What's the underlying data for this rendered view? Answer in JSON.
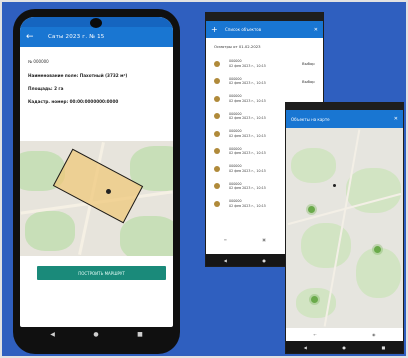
{
  "phone1": {
    "title": "Саты 2023 г. № 15",
    "back_icon": "arrow-left-icon",
    "record_id": "№ 000000",
    "rows": [
      "Наименование поле: Пахотный (3732 м²)",
      "Площадь: 2 га",
      "Кадастр. номер: 00:00:0000000:0000"
    ],
    "button_label": "ПОСТРОИТЬ МАРШРУТ",
    "colors": {
      "appbar": "#1976d2",
      "button": "#1a8a7a",
      "polygon": "#f0c878"
    }
  },
  "phone2": {
    "title": "Список объектов",
    "header": "Осмотры от 01.02.2023",
    "items": [
      {
        "line1": "000000",
        "line2": "02 фев 2023 г., 10:15",
        "tag": "Выбор"
      },
      {
        "line1": "000000",
        "line2": "02 фев 2023 г., 10:15",
        "tag": "Выбор"
      },
      {
        "line1": "000000",
        "line2": "02 фев 2023 г., 10:15",
        "tag": ""
      },
      {
        "line1": "000000",
        "line2": "02 фев 2023 г., 10:15",
        "tag": ""
      },
      {
        "line1": "000000",
        "line2": "02 фев 2023 г., 10:15",
        "tag": ""
      },
      {
        "line1": "000000",
        "line2": "02 фев 2023 г., 10:15",
        "tag": ""
      },
      {
        "line1": "000000",
        "line2": "02 фев 2023 г., 10:15",
        "tag": ""
      },
      {
        "line1": "000000",
        "line2": "02 фев 2023 г., 10:15",
        "tag": ""
      },
      {
        "line1": "000000",
        "line2": "02 фев 2023 г., 10:15",
        "tag": ""
      }
    ]
  },
  "phone3": {
    "title": "Объекты на карте"
  }
}
